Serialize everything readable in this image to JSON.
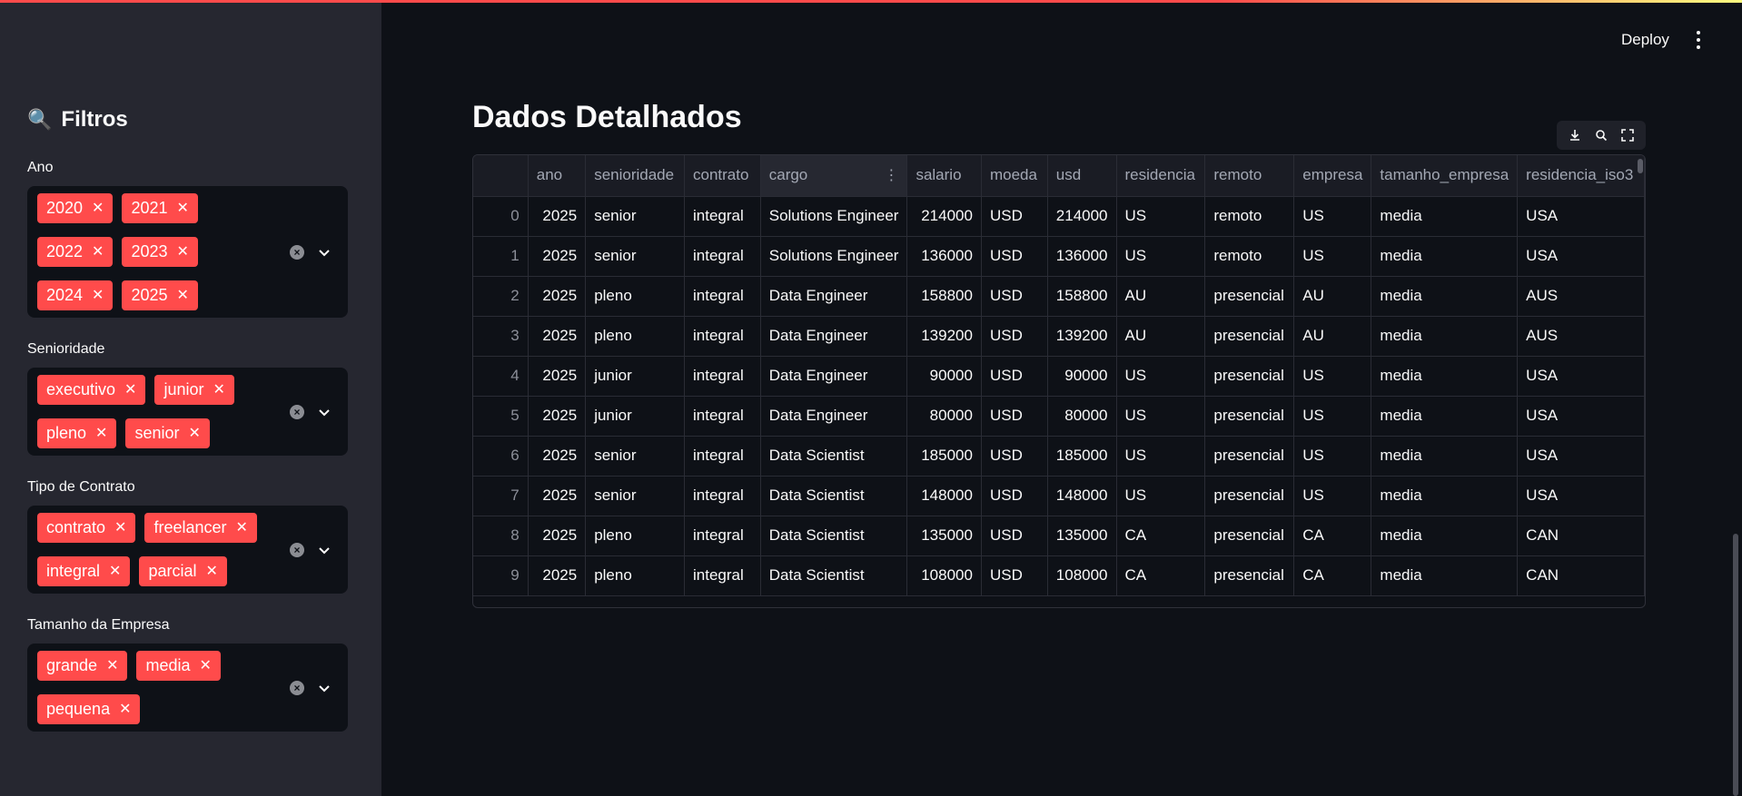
{
  "header": {
    "deploy_label": "Deploy"
  },
  "sidebar": {
    "title": "Filtros",
    "filters": [
      {
        "label": "Ano",
        "chips": [
          "2020",
          "2021",
          "2022",
          "2023",
          "2024",
          "2025"
        ]
      },
      {
        "label": "Senioridade",
        "chips": [
          "executivo",
          "junior",
          "pleno",
          "senior"
        ]
      },
      {
        "label": "Tipo de Contrato",
        "chips": [
          "contrato",
          "freelancer",
          "integral",
          "parcial"
        ]
      },
      {
        "label": "Tamanho da Empresa",
        "chips": [
          "grande",
          "media",
          "pequena"
        ]
      }
    ]
  },
  "main": {
    "title": "Dados Detalhados",
    "columns": [
      "",
      "ano",
      "senioridade",
      "contrato",
      "cargo",
      "salario",
      "moeda",
      "usd",
      "residencia",
      "remoto",
      "empresa",
      "tamanho_empresa",
      "residencia_iso3"
    ],
    "rows": [
      [
        "0",
        "2025",
        "senior",
        "integral",
        "Solutions Engineer",
        "214000",
        "USD",
        "214000",
        "US",
        "remoto",
        "US",
        "media",
        "USA"
      ],
      [
        "1",
        "2025",
        "senior",
        "integral",
        "Solutions Engineer",
        "136000",
        "USD",
        "136000",
        "US",
        "remoto",
        "US",
        "media",
        "USA"
      ],
      [
        "2",
        "2025",
        "pleno",
        "integral",
        "Data Engineer",
        "158800",
        "USD",
        "158800",
        "AU",
        "presencial",
        "AU",
        "media",
        "AUS"
      ],
      [
        "3",
        "2025",
        "pleno",
        "integral",
        "Data Engineer",
        "139200",
        "USD",
        "139200",
        "AU",
        "presencial",
        "AU",
        "media",
        "AUS"
      ],
      [
        "4",
        "2025",
        "junior",
        "integral",
        "Data Engineer",
        "90000",
        "USD",
        "90000",
        "US",
        "presencial",
        "US",
        "media",
        "USA"
      ],
      [
        "5",
        "2025",
        "junior",
        "integral",
        "Data Engineer",
        "80000",
        "USD",
        "80000",
        "US",
        "presencial",
        "US",
        "media",
        "USA"
      ],
      [
        "6",
        "2025",
        "senior",
        "integral",
        "Data Scientist",
        "185000",
        "USD",
        "185000",
        "US",
        "presencial",
        "US",
        "media",
        "USA"
      ],
      [
        "7",
        "2025",
        "senior",
        "integral",
        "Data Scientist",
        "148000",
        "USD",
        "148000",
        "US",
        "presencial",
        "US",
        "media",
        "USA"
      ],
      [
        "8",
        "2025",
        "pleno",
        "integral",
        "Data Scientist",
        "135000",
        "USD",
        "135000",
        "CA",
        "presencial",
        "CA",
        "media",
        "CAN"
      ],
      [
        "9",
        "2025",
        "pleno",
        "integral",
        "Data Scientist",
        "108000",
        "USD",
        "108000",
        "CA",
        "presencial",
        "CA",
        "media",
        "CAN"
      ]
    ]
  },
  "colors": {
    "accent": "#ff4b4b",
    "sidebar_bg": "#262730",
    "main_bg": "#0e1117"
  }
}
